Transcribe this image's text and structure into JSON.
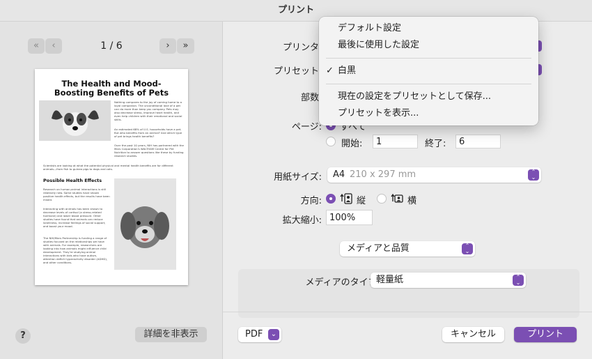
{
  "window": {
    "title": "プリント"
  },
  "preview": {
    "page_indicator": "1 / 6",
    "doc_title": "The Health and Mood-Boosting Benefits of Pets",
    "paragraph1": "Nothing compares to the joy of coming home to a loyal companion. The unconditional love of a pet can do more than keep you company. Pets may also decrease stress, improve heart health, and even help children with their emotional and social skills.",
    "paragraph2": "An estimated 68% of U.S. households have a pet. But who benefits from an animal? And which type of pet brings health benefits?",
    "paragraph3": "Over the past 10 years, NIH has partnered with the Mars Corporation's WALTHAM Centre for Pet Nutrition to answer questions like these by funding research studies.",
    "paragraph4": "Scientists are looking at what the potential physical and mental health benefits are for different animals—from fish to guinea pigs to dogs and cats.",
    "subheading": "Possible Health Effects",
    "paragraph5": "Research on human-animal interactions is still relatively new. Some studies have shown positive health effects, but the results have been mixed.",
    "paragraph6": "Interacting with animals has been shown to decrease levels of cortisol (a stress-related hormone) and lower blood pressure. Other studies have found that animals can reduce loneliness, increase feelings of social support, and boost your mood.",
    "paragraph7": "The NIH/Mars Partnership is funding a range of studies focused on the relationships we have with animals. For example, researchers are looking into how animals might influence child development. They're studying animal interactions with kids who have autism, attention deficit hyperactivity disorder (ADHD), and other conditions."
  },
  "left_footer": {
    "help": "?",
    "details_button": "詳細を非表示"
  },
  "form": {
    "printer_label": "プリンタ",
    "preset_label": "プリセット",
    "copies_label": "部数",
    "pages_label": "ページ:",
    "pages_all": "すべて",
    "pages_from_label": "開始:",
    "pages_from_value": "1",
    "pages_to_label": "終了:",
    "pages_to_value": "6",
    "paper_size_label": "用紙サイズ:",
    "paper_size_value": "A4",
    "paper_size_dims": "210 x 297 mm",
    "orientation_label": "方向:",
    "orientation_portrait": "縦",
    "orientation_landscape": "横",
    "scale_label": "拡大縮小:",
    "scale_value": "100%",
    "section_popup": "メディアと品質",
    "media_type_label": "メディアのタイプ:",
    "media_type_value": "軽量紙"
  },
  "footer": {
    "pdf": "PDF",
    "cancel": "キャンセル",
    "print": "プリント"
  },
  "preset_menu": {
    "items": [
      "デフォルト設定",
      "最後に使用した設定",
      "白黒",
      "現在の設定をプリセットとして保存...",
      "プリセットを表示..."
    ],
    "checked": "✓"
  },
  "colors": {
    "accent": "#7b4fb3"
  }
}
